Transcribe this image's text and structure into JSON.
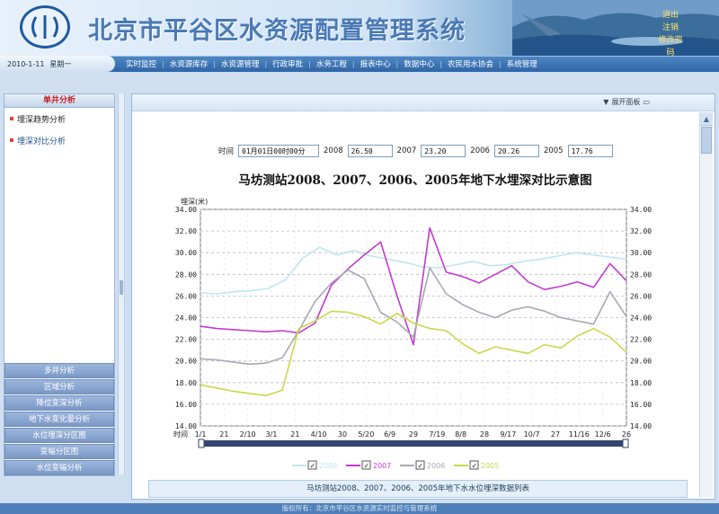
{
  "header": {
    "system_title": "北京市平谷区水资源配置管理系统",
    "right_links": [
      "退出",
      "注销",
      "修改密码"
    ],
    "date": "2010-1-11",
    "weekday": "星期一"
  },
  "nav": {
    "items": [
      "实时监控",
      "水资源库存",
      "水资源管理",
      "行政审批",
      "水务工程",
      "报表中心",
      "数据中心",
      "农民用水协会",
      "系统管理"
    ]
  },
  "sidebar": {
    "title": "单井分析",
    "items": [
      "埋深趋势分析",
      "埋深对比分析"
    ],
    "bottom_items": [
      "多井分析",
      "区域分析",
      "降位变深分析",
      "地下水变化量分析",
      "水位埋深分区图",
      "变幅分区图",
      "水位变幅分析"
    ]
  },
  "content": {
    "expand_panel_label": "展开面板",
    "params": {
      "time_label": "时间",
      "time_value": "01月01日00时00分",
      "y2008_label": "2008",
      "y2008_value": "26.50",
      "y2007_label": "2007",
      "y2007_value": "23.20",
      "y2006_label": "2006",
      "y2006_value": "20.26",
      "y2005_label": "2005",
      "y2005_value": "17.76"
    },
    "table_title": "马坊测站2008、2007、2006、2005年地下水水位埋深数据列表"
  },
  "footer": {
    "text": "版权所有：北京市平谷区水资源实时监控与管理系统"
  },
  "chart_data": {
    "type": "line",
    "title": "马坊测站2008、2007、2006、2005年地下水埋深对比示意图",
    "ylabel": "埋深(米)",
    "xlabel": "时间",
    "ylim": [
      14,
      34
    ],
    "yticks": [
      "34.00",
      "32.00",
      "30.00",
      "28.00",
      "26.00",
      "24.00",
      "22.00",
      "20.00",
      "18.00",
      "16.00",
      "14.00"
    ],
    "x_tick_labels": [
      "1/1",
      "21",
      "2/10",
      "3/1",
      "21",
      "4/10",
      "30",
      "5/20",
      "6/9",
      "29",
      "7/19",
      "8/8",
      "28",
      "9/17",
      "10/7",
      "27",
      "11/16",
      "12/6",
      "26"
    ],
    "grid": true,
    "legend_position": "bottom",
    "series": [
      {
        "name": "2008",
        "color": "#bfe6ef",
        "values": [
          26.3,
          26.2,
          26.4,
          26.5,
          26.7,
          27.5,
          29.5,
          30.5,
          29.8,
          30.2,
          29.7,
          29.4,
          29.1,
          28.7,
          28.6,
          28.9,
          29.2,
          28.8,
          28.9,
          29.2,
          29.4,
          29.7,
          30.0,
          29.8,
          29.6,
          29.4
        ]
      },
      {
        "name": "2007",
        "color": "#c23ad0",
        "values": [
          23.2,
          23.0,
          22.9,
          22.8,
          22.7,
          22.8,
          22.6,
          23.5,
          27.0,
          28.5,
          29.8,
          31.0,
          26.0,
          21.5,
          32.3,
          28.2,
          27.8,
          27.2,
          28.0,
          28.8,
          27.3,
          26.6,
          26.9,
          27.3,
          26.8,
          29.0,
          27.4
        ]
      },
      {
        "name": "2006",
        "color": "#a8a8b4",
        "values": [
          20.2,
          20.1,
          19.9,
          19.7,
          19.8,
          20.3,
          22.8,
          25.5,
          27.2,
          28.4,
          27.6,
          24.5,
          23.6,
          22.2,
          28.6,
          26.2,
          25.2,
          24.5,
          24.0,
          24.7,
          25.0,
          24.6,
          24.0,
          23.7,
          23.4,
          26.4,
          24.1
        ]
      },
      {
        "name": "2005",
        "color": "#c9d84a",
        "values": [
          17.8,
          17.5,
          17.2,
          17.0,
          16.8,
          17.3,
          23.0,
          23.7,
          24.6,
          24.5,
          24.1,
          23.4,
          24.4,
          23.5,
          23.0,
          22.8,
          21.6,
          20.7,
          21.3,
          21.0,
          20.7,
          21.5,
          21.2,
          22.3,
          23.0,
          22.2,
          20.8
        ]
      }
    ]
  }
}
